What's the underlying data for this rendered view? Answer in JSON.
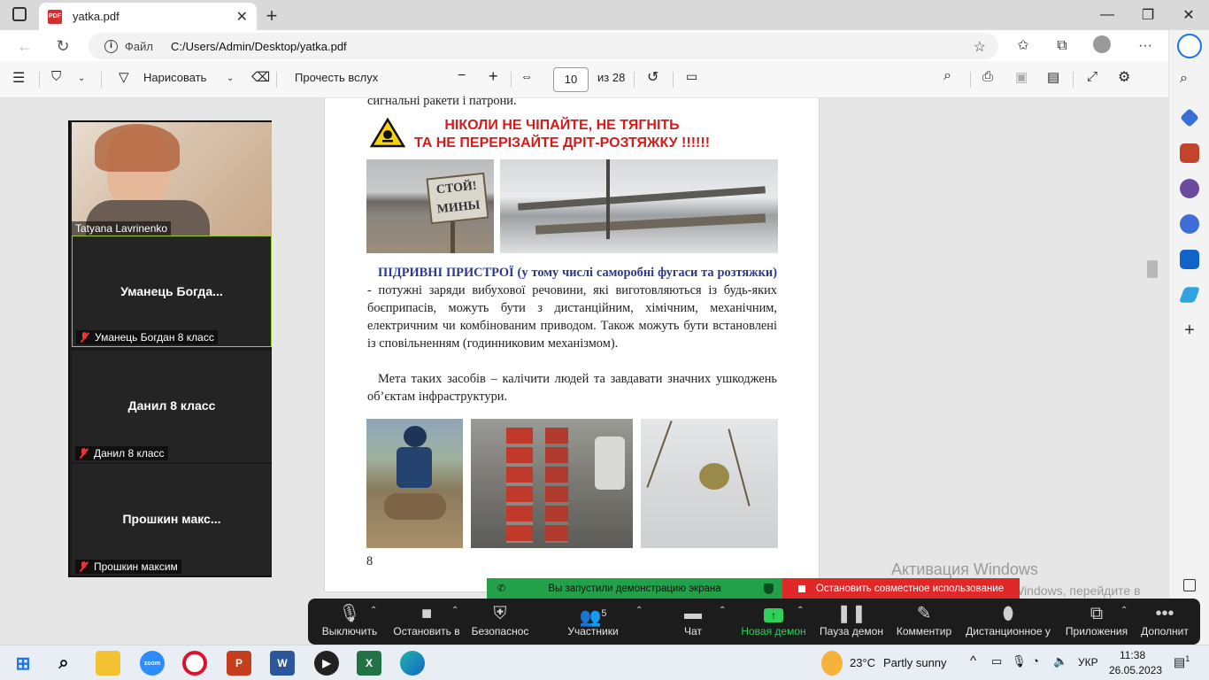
{
  "browser": {
    "tab_title": "yatka.pdf",
    "address_label": "Файл",
    "address_url": "C:/Users/Admin/Desktop/yatka.pdf"
  },
  "pdf_toolbar": {
    "draw_label": "Нарисовать",
    "read_aloud_label": "Прочесть вслух",
    "page_current": "10",
    "page_total": "из 28"
  },
  "pdf_page": {
    "line_top": "сигнальні ракети і патрони.",
    "warning_line1": "НІКОЛИ НЕ ЧІПАЙТЕ, НЕ ТЯГНІТЬ",
    "warning_line2": "ТА НЕ ПЕРЕРІЗАЙТЕ ДРІТ-РОЗТЯЖКУ  !!!!!!",
    "sign_text": "СТОЙ! МИНЫ",
    "para1_heading": "ПІДРИВНІ ПРИСТРОЇ (у тому числі саморобні фугаси та розтяжки)",
    "para1_body": " - потужні заряди вибухової речовини, які виготовляються із будь-яких боєприпасів, можуть бути з дистанційним, хімічним, механічним, електричним чи комбінованим приводом. Також можуть бути встановлені із сповільненням (годинниковим механізмом).",
    "para2": "Мета таких засобів – калічити людей та завдавати значних ушкоджень об’єктам інфраструктури.",
    "page_number": "8"
  },
  "zoom": {
    "participants": [
      {
        "display_name": "",
        "label": "Tatyana Lavrinenko",
        "muted": false
      },
      {
        "display_name": "Уманець  Богда...",
        "label": "Уманець Богдан 8 класс",
        "muted": true
      },
      {
        "display_name": "Данил 8 класс",
        "label": "Данил 8 класс",
        "muted": true
      },
      {
        "display_name": "Прошкин  макс...",
        "label": "Прошкин максим",
        "muted": true
      }
    ],
    "share_banner": "Вы запустили демонстрацию экрана",
    "stop_share": "Остановить совместное использование",
    "controls": {
      "mute": "Выключить",
      "video": "Остановить в",
      "security": "Безопаснос",
      "participants": "Участники",
      "participants_count": "5",
      "chat": "Чат",
      "new_share": "Новая демон",
      "pause_share": "Пауза демон",
      "annotate": "Комментир",
      "remote": "Дистанционное у",
      "apps": "Приложения",
      "more": "Дополнит"
    }
  },
  "activation": {
    "title": "Активация Windows",
    "body": "Чтобы активировать Windows, перейдите в раздел \"Параметры\"."
  },
  "taskbar": {
    "weather_temp": "23°C",
    "weather_text": "Partly sunny",
    "lang": "УКР",
    "time": "11:38",
    "date": "26.05.2023",
    "notification_count": "1"
  },
  "colors": {
    "warning_red": "#d51b1b",
    "heading_blue": "#2b3a8f",
    "share_green": "#23a14a",
    "stop_red": "#e02828"
  }
}
